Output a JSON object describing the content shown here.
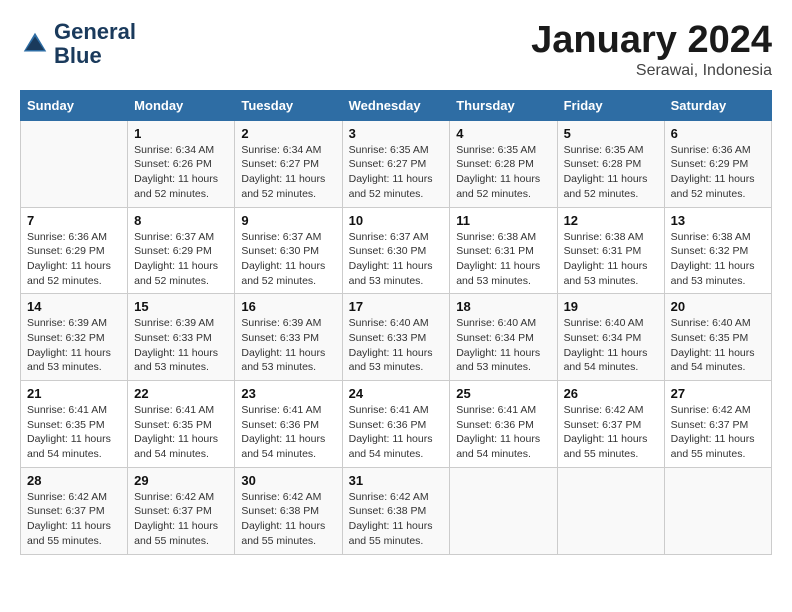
{
  "header": {
    "logo_line1": "General",
    "logo_line2": "Blue",
    "month": "January 2024",
    "location": "Serawai, Indonesia"
  },
  "days_of_week": [
    "Sunday",
    "Monday",
    "Tuesday",
    "Wednesday",
    "Thursday",
    "Friday",
    "Saturday"
  ],
  "weeks": [
    [
      {
        "day": "",
        "sunrise": "",
        "sunset": "",
        "daylight": ""
      },
      {
        "day": "1",
        "sunrise": "Sunrise: 6:34 AM",
        "sunset": "Sunset: 6:26 PM",
        "daylight": "Daylight: 11 hours and 52 minutes."
      },
      {
        "day": "2",
        "sunrise": "Sunrise: 6:34 AM",
        "sunset": "Sunset: 6:27 PM",
        "daylight": "Daylight: 11 hours and 52 minutes."
      },
      {
        "day": "3",
        "sunrise": "Sunrise: 6:35 AM",
        "sunset": "Sunset: 6:27 PM",
        "daylight": "Daylight: 11 hours and 52 minutes."
      },
      {
        "day": "4",
        "sunrise": "Sunrise: 6:35 AM",
        "sunset": "Sunset: 6:28 PM",
        "daylight": "Daylight: 11 hours and 52 minutes."
      },
      {
        "day": "5",
        "sunrise": "Sunrise: 6:35 AM",
        "sunset": "Sunset: 6:28 PM",
        "daylight": "Daylight: 11 hours and 52 minutes."
      },
      {
        "day": "6",
        "sunrise": "Sunrise: 6:36 AM",
        "sunset": "Sunset: 6:29 PM",
        "daylight": "Daylight: 11 hours and 52 minutes."
      }
    ],
    [
      {
        "day": "7",
        "sunrise": "Sunrise: 6:36 AM",
        "sunset": "Sunset: 6:29 PM",
        "daylight": "Daylight: 11 hours and 52 minutes."
      },
      {
        "day": "8",
        "sunrise": "Sunrise: 6:37 AM",
        "sunset": "Sunset: 6:29 PM",
        "daylight": "Daylight: 11 hours and 52 minutes."
      },
      {
        "day": "9",
        "sunrise": "Sunrise: 6:37 AM",
        "sunset": "Sunset: 6:30 PM",
        "daylight": "Daylight: 11 hours and 52 minutes."
      },
      {
        "day": "10",
        "sunrise": "Sunrise: 6:37 AM",
        "sunset": "Sunset: 6:30 PM",
        "daylight": "Daylight: 11 hours and 53 minutes."
      },
      {
        "day": "11",
        "sunrise": "Sunrise: 6:38 AM",
        "sunset": "Sunset: 6:31 PM",
        "daylight": "Daylight: 11 hours and 53 minutes."
      },
      {
        "day": "12",
        "sunrise": "Sunrise: 6:38 AM",
        "sunset": "Sunset: 6:31 PM",
        "daylight": "Daylight: 11 hours and 53 minutes."
      },
      {
        "day": "13",
        "sunrise": "Sunrise: 6:38 AM",
        "sunset": "Sunset: 6:32 PM",
        "daylight": "Daylight: 11 hours and 53 minutes."
      }
    ],
    [
      {
        "day": "14",
        "sunrise": "Sunrise: 6:39 AM",
        "sunset": "Sunset: 6:32 PM",
        "daylight": "Daylight: 11 hours and 53 minutes."
      },
      {
        "day": "15",
        "sunrise": "Sunrise: 6:39 AM",
        "sunset": "Sunset: 6:33 PM",
        "daylight": "Daylight: 11 hours and 53 minutes."
      },
      {
        "day": "16",
        "sunrise": "Sunrise: 6:39 AM",
        "sunset": "Sunset: 6:33 PM",
        "daylight": "Daylight: 11 hours and 53 minutes."
      },
      {
        "day": "17",
        "sunrise": "Sunrise: 6:40 AM",
        "sunset": "Sunset: 6:33 PM",
        "daylight": "Daylight: 11 hours and 53 minutes."
      },
      {
        "day": "18",
        "sunrise": "Sunrise: 6:40 AM",
        "sunset": "Sunset: 6:34 PM",
        "daylight": "Daylight: 11 hours and 53 minutes."
      },
      {
        "day": "19",
        "sunrise": "Sunrise: 6:40 AM",
        "sunset": "Sunset: 6:34 PM",
        "daylight": "Daylight: 11 hours and 54 minutes."
      },
      {
        "day": "20",
        "sunrise": "Sunrise: 6:40 AM",
        "sunset": "Sunset: 6:35 PM",
        "daylight": "Daylight: 11 hours and 54 minutes."
      }
    ],
    [
      {
        "day": "21",
        "sunrise": "Sunrise: 6:41 AM",
        "sunset": "Sunset: 6:35 PM",
        "daylight": "Daylight: 11 hours and 54 minutes."
      },
      {
        "day": "22",
        "sunrise": "Sunrise: 6:41 AM",
        "sunset": "Sunset: 6:35 PM",
        "daylight": "Daylight: 11 hours and 54 minutes."
      },
      {
        "day": "23",
        "sunrise": "Sunrise: 6:41 AM",
        "sunset": "Sunset: 6:36 PM",
        "daylight": "Daylight: 11 hours and 54 minutes."
      },
      {
        "day": "24",
        "sunrise": "Sunrise: 6:41 AM",
        "sunset": "Sunset: 6:36 PM",
        "daylight": "Daylight: 11 hours and 54 minutes."
      },
      {
        "day": "25",
        "sunrise": "Sunrise: 6:41 AM",
        "sunset": "Sunset: 6:36 PM",
        "daylight": "Daylight: 11 hours and 54 minutes."
      },
      {
        "day": "26",
        "sunrise": "Sunrise: 6:42 AM",
        "sunset": "Sunset: 6:37 PM",
        "daylight": "Daylight: 11 hours and 55 minutes."
      },
      {
        "day": "27",
        "sunrise": "Sunrise: 6:42 AM",
        "sunset": "Sunset: 6:37 PM",
        "daylight": "Daylight: 11 hours and 55 minutes."
      }
    ],
    [
      {
        "day": "28",
        "sunrise": "Sunrise: 6:42 AM",
        "sunset": "Sunset: 6:37 PM",
        "daylight": "Daylight: 11 hours and 55 minutes."
      },
      {
        "day": "29",
        "sunrise": "Sunrise: 6:42 AM",
        "sunset": "Sunset: 6:37 PM",
        "daylight": "Daylight: 11 hours and 55 minutes."
      },
      {
        "day": "30",
        "sunrise": "Sunrise: 6:42 AM",
        "sunset": "Sunset: 6:38 PM",
        "daylight": "Daylight: 11 hours and 55 minutes."
      },
      {
        "day": "31",
        "sunrise": "Sunrise: 6:42 AM",
        "sunset": "Sunset: 6:38 PM",
        "daylight": "Daylight: 11 hours and 55 minutes."
      },
      {
        "day": "",
        "sunrise": "",
        "sunset": "",
        "daylight": ""
      },
      {
        "day": "",
        "sunrise": "",
        "sunset": "",
        "daylight": ""
      },
      {
        "day": "",
        "sunrise": "",
        "sunset": "",
        "daylight": ""
      }
    ]
  ]
}
